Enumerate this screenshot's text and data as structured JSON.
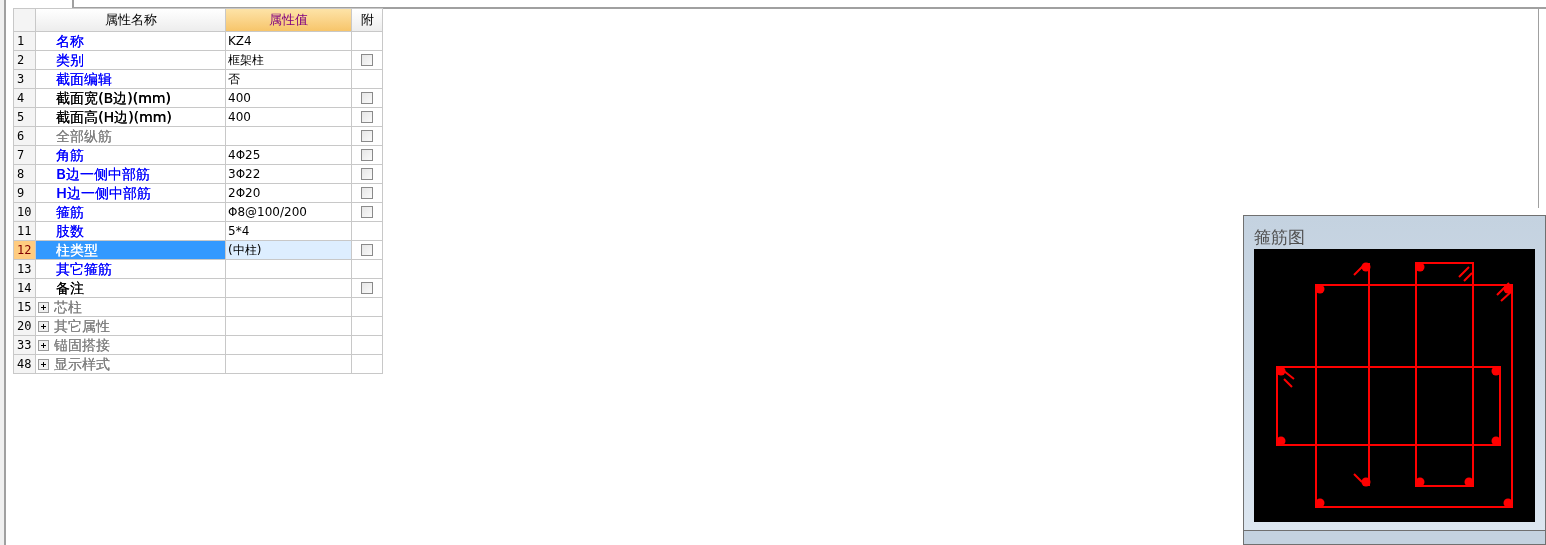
{
  "table": {
    "columns": [
      "属性名称",
      "属性值",
      "附"
    ],
    "rows": [
      {
        "kind": "property",
        "index": "1",
        "name": "名称",
        "color": "#0000ff",
        "value": "KZ4",
        "selected": false
      },
      {
        "kind": "property",
        "index": "2",
        "name": "类别",
        "color": "#0000ff",
        "value": "框架柱",
        "selected": false,
        "checked": false
      },
      {
        "kind": "property",
        "index": "3",
        "name": "截面编辑",
        "color": "#0000ff",
        "value": "否",
        "selected": false
      },
      {
        "kind": "property",
        "index": "4",
        "name": "截面宽(B边)(mm)",
        "color": "#000000",
        "value": "400",
        "selected": false,
        "checked": false
      },
      {
        "kind": "property",
        "index": "5",
        "name": "截面高(H边)(mm)",
        "color": "#000000",
        "value": "400",
        "selected": false,
        "checked": false
      },
      {
        "kind": "property",
        "index": "6",
        "name": "全部纵筋",
        "color": "#808080",
        "selected": false,
        "checked": false
      },
      {
        "kind": "property",
        "index": "7",
        "name": "角筋",
        "color": "#0000ff",
        "value": "4Φ25",
        "selected": false,
        "checked": false
      },
      {
        "kind": "property",
        "index": "8",
        "name": "B边一侧中部筋",
        "color": "#0000ff",
        "value": "3Φ22",
        "selected": false,
        "checked": false
      },
      {
        "kind": "property",
        "index": "9",
        "name": "H边一侧中部筋",
        "color": "#0000ff",
        "value": "2Φ20",
        "selected": false,
        "checked": false
      },
      {
        "kind": "property",
        "index": "10",
        "name": "箍筋",
        "color": "#0000ff",
        "value": "Φ8@100/200",
        "selected": false,
        "checked": false
      },
      {
        "kind": "property",
        "index": "11",
        "name": "肢数",
        "color": "#0000ff",
        "value": "5*4",
        "selected": false
      },
      {
        "kind": "property",
        "index": "12",
        "name": "柱类型",
        "value": "(中柱)",
        "selected": true,
        "checked": false
      },
      {
        "kind": "property",
        "index": "13",
        "name": "其它箍筋",
        "color": "#0000ff",
        "selected": false
      },
      {
        "kind": "property",
        "index": "14",
        "name": "备注",
        "color": "#000000",
        "selected": false,
        "checked": false
      },
      {
        "kind": "group",
        "index": "15",
        "name": "芯柱",
        "color": "#808080",
        "expanded": false,
        "selected": false
      },
      {
        "kind": "group",
        "index": "20",
        "name": "其它属性",
        "color": "#808080",
        "expanded": false,
        "selected": false
      },
      {
        "kind": "group",
        "index": "33",
        "name": "锚固搭接",
        "color": "#808080",
        "expanded": false,
        "selected": false
      },
      {
        "kind": "group",
        "index": "48",
        "name": "显示样式",
        "color": "#808080",
        "expanded": false,
        "selected": false
      }
    ]
  },
  "stirrup_panel": {
    "title": "箍筋图"
  }
}
